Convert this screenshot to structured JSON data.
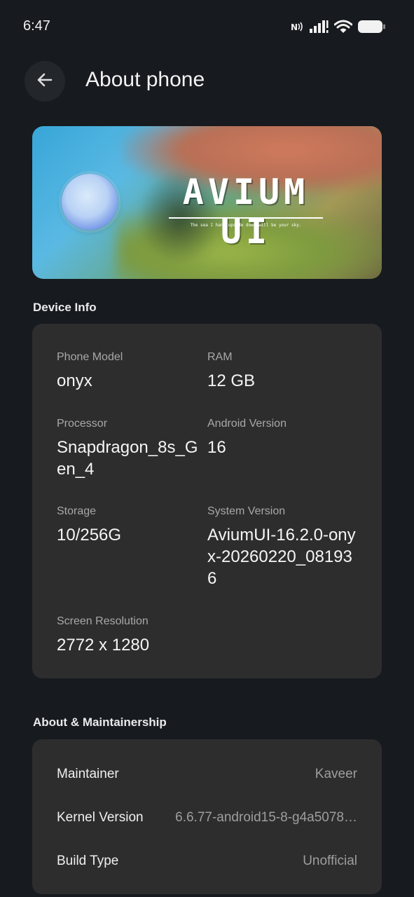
{
  "status_bar": {
    "time": "6:47",
    "icons": [
      "nfc-icon",
      "signal-icon",
      "wifi-icon",
      "battery-icon"
    ]
  },
  "app_bar": {
    "title": "About phone",
    "back_icon": "back-arrow-icon"
  },
  "banner": {
    "brand": "AVIUM UI",
    "tagline": "The sea I hang upside down will be your sky."
  },
  "device_info": {
    "section_title": "Device Info",
    "items": [
      {
        "label": "Phone Model",
        "value": "onyx"
      },
      {
        "label": "RAM",
        "value": "12 GB"
      },
      {
        "label": "Processor",
        "value": "Snapdragon_8s_Gen_4"
      },
      {
        "label": "Android Version",
        "value": "16"
      },
      {
        "label": "Storage",
        "value": "10/256G"
      },
      {
        "label": "System Version",
        "value": "AviumUI-16.2.0-onyx-20260220_081936"
      },
      {
        "label": "Screen Resolution",
        "value": "2772 x 1280"
      }
    ]
  },
  "about": {
    "section_title": "About & Maintainership",
    "rows": [
      {
        "label": "Maintainer",
        "value": "Kaveer"
      },
      {
        "label": "Kernel Version",
        "value": "6.6.77-android15-8-g4a5078…"
      },
      {
        "label": "Build Type",
        "value": "Unofficial"
      }
    ]
  },
  "colors": {
    "background": "#171a1e",
    "card": "#2d2d2e",
    "label_text": "#a8a8a8",
    "value_text": "#f5f5f5"
  }
}
